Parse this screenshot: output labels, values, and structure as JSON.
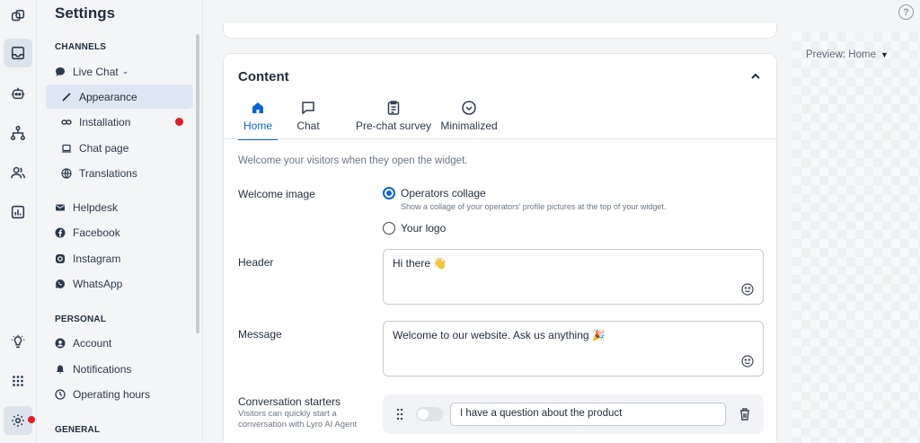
{
  "app": {
    "title": "Settings",
    "help_symbol": "?"
  },
  "sidebar": {
    "sections": [
      {
        "title": "CHANNELS"
      },
      {
        "title": "PERSONAL"
      },
      {
        "title": "GENERAL"
      }
    ],
    "items": [
      {
        "label": "Live Chat",
        "icon": "chat-bubble-icon",
        "caret": "⌄"
      },
      {
        "label": "Appearance",
        "icon": "brush-icon",
        "active": true
      },
      {
        "label": "Installation",
        "icon": "link-icon",
        "badge": "red-dot"
      },
      {
        "label": "Chat page",
        "icon": "laptop-icon"
      },
      {
        "label": "Translations",
        "icon": "globe-icon"
      },
      {
        "label": "Helpdesk",
        "icon": "mail-icon"
      },
      {
        "label": "Facebook",
        "icon": "facebook-icon"
      },
      {
        "label": "Instagram",
        "icon": "instagram-icon"
      },
      {
        "label": "WhatsApp",
        "icon": "whatsapp-icon"
      },
      {
        "label": "Account",
        "icon": "user-icon"
      },
      {
        "label": "Notifications",
        "icon": "bell-icon"
      },
      {
        "label": "Operating hours",
        "icon": "clock-icon"
      }
    ]
  },
  "rail": {
    "icons": [
      "layers-icon",
      "inbox-icon",
      "bot-icon",
      "flow-icon",
      "contacts-icon",
      "analytics-icon",
      "lightbulb-icon",
      "apps-grid-icon",
      "settings-gear-icon"
    ]
  },
  "content": {
    "card_title": "Content",
    "tabs": [
      {
        "label": "Home",
        "icon": "home-icon",
        "active": true
      },
      {
        "label": "Chat",
        "icon": "chat-icon"
      },
      {
        "label": "Pre-chat survey",
        "icon": "clipboard-icon"
      },
      {
        "label": "Minimalized",
        "icon": "chevron-circle-icon"
      }
    ],
    "intro": "Welcome your visitors when they open the widget.",
    "welcome_image": {
      "label": "Welcome image",
      "options": [
        {
          "label": "Operators collage",
          "selected": true,
          "sub": "Show a collage of your operators' profile pictures at the top of your widget."
        },
        {
          "label": "Your logo",
          "selected": false
        }
      ]
    },
    "header": {
      "label": "Header",
      "value": "Hi there 👋"
    },
    "message": {
      "label": "Message",
      "value": "Welcome to our website. Ask us anything 🎉"
    },
    "starters": {
      "label": "Conversation starters",
      "sub": "Visitors can quickly start a conversation with Lyro AI Agent",
      "items": [
        {
          "value": "I have a question about the product",
          "enabled": false
        }
      ]
    }
  },
  "preview": {
    "label": "Preview: Home",
    "caret": "▼"
  },
  "colors": {
    "accent": "#0a63d8",
    "alert": "#e31b23",
    "active_nav_bg": "#dde6f3"
  }
}
